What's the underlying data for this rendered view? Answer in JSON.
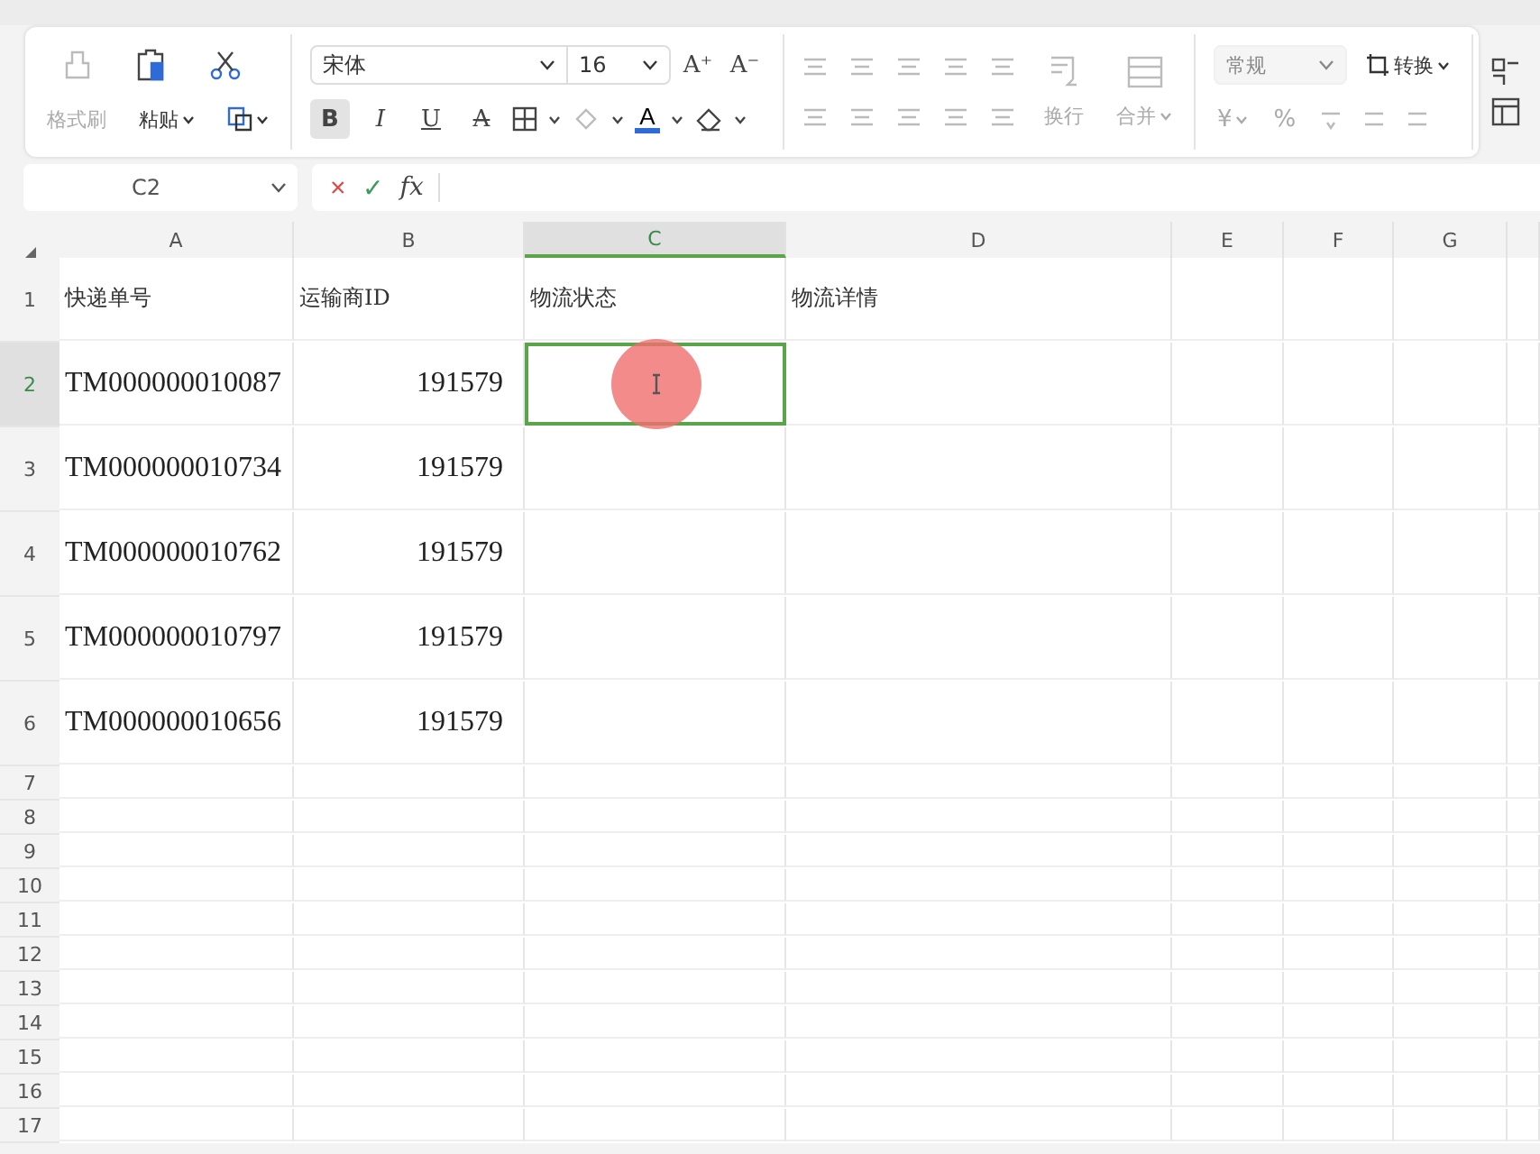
{
  "ribbon": {
    "clipboard": {
      "buttons": [
        {
          "label": "格式刷",
          "disabled": true
        },
        {
          "label": "粘贴",
          "disabled": false
        }
      ]
    },
    "font": {
      "name": "宋体",
      "size": "16",
      "size_buttons": [
        "A⁺",
        "A⁻"
      ],
      "styles": [
        {
          "label": "B",
          "selected": true
        },
        {
          "label": "I",
          "selected": false
        },
        {
          "label": "U",
          "selected": false
        },
        {
          "label": "A",
          "selected": false
        }
      ],
      "color_label": "A"
    },
    "alignment": {
      "buttons": [
        {
          "label": "换行",
          "disabled": true
        },
        {
          "label": "合并",
          "disabled": true
        }
      ]
    },
    "number": {
      "format": "常规",
      "convert": "转换",
      "symbols": [
        "¥",
        "%"
      ]
    }
  },
  "formula_bar": {
    "name_box": "C2",
    "cancel": "×",
    "confirm": "✓",
    "function": "fx"
  },
  "sheet": {
    "columns": [
      {
        "label": "A",
        "selected": false
      },
      {
        "label": "B",
        "selected": false
      },
      {
        "label": "C",
        "selected": true
      },
      {
        "label": "D",
        "selected": false
      },
      {
        "label": "E",
        "selected": false
      },
      {
        "label": "F",
        "selected": false
      },
      {
        "label": "G",
        "selected": false
      }
    ],
    "rows": [
      {
        "number": "1",
        "selected": false,
        "cells": [
          {
            "kind": "header",
            "text": "快递单号"
          },
          {
            "kind": "header",
            "text": "运输商ID"
          },
          {
            "kind": "header",
            "text": "物流状态"
          },
          {
            "kind": "header",
            "text": "物流详情"
          }
        ]
      },
      {
        "number": "2",
        "selected": true,
        "cells": [
          {
            "kind": "text",
            "text": "TM000000010087"
          },
          {
            "kind": "number",
            "text": "191579"
          }
        ]
      },
      {
        "number": "3",
        "selected": false,
        "cells": [
          {
            "kind": "text",
            "text": "TM000000010734"
          },
          {
            "kind": "number",
            "text": "191579"
          }
        ]
      },
      {
        "number": "4",
        "selected": false,
        "cells": [
          {
            "kind": "text",
            "text": "TM000000010762"
          },
          {
            "kind": "number",
            "text": "191579"
          }
        ]
      },
      {
        "number": "5",
        "selected": false,
        "cells": [
          {
            "kind": "text",
            "text": "TM000000010797"
          },
          {
            "kind": "number",
            "text": "191579"
          }
        ]
      },
      {
        "number": "6",
        "selected": false,
        "cells": [
          {
            "kind": "text",
            "text": "TM000000010656"
          },
          {
            "kind": "number",
            "text": "191579"
          }
        ]
      },
      {
        "number": "7",
        "selected": false
      },
      {
        "number": "8",
        "selected": false
      },
      {
        "number": "9",
        "selected": false
      },
      {
        "number": "10",
        "selected": false
      },
      {
        "number": "11",
        "selected": false
      },
      {
        "number": "12",
        "selected": false
      },
      {
        "number": "13",
        "selected": false
      },
      {
        "number": "14",
        "selected": false
      },
      {
        "number": "15",
        "selected": false
      },
      {
        "number": "16",
        "selected": false
      },
      {
        "number": "17",
        "selected": false
      }
    ]
  }
}
